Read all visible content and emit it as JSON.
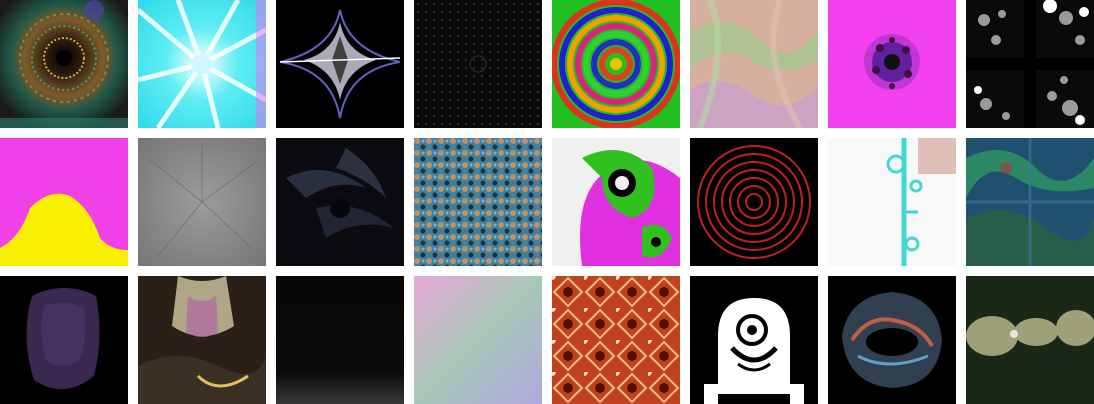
{
  "gallery": {
    "rows": 3,
    "columns": 8,
    "tiles": [
      {
        "name": "dark-mandala-pattern",
        "dominant_colors": [
          "#1a1a1a",
          "#c08030",
          "#30a080"
        ]
      },
      {
        "name": "cyan-starburst-pattern",
        "dominant_colors": [
          "#40e8f0",
          "#ffffff",
          "#f070f0"
        ]
      },
      {
        "name": "white-cross-star-on-black",
        "dominant_colors": [
          "#000000",
          "#d8d8f0",
          "#6060c0"
        ]
      },
      {
        "name": "dark-dotted-texture",
        "dominant_colors": [
          "#0c0c0c",
          "#2a2a2a"
        ]
      },
      {
        "name": "rainbow-concentric-rings",
        "dominant_colors": [
          "#20c020",
          "#e03020",
          "#2020d0",
          "#f0a000"
        ]
      },
      {
        "name": "pastel-marbled-texture",
        "dominant_colors": [
          "#d8b0a0",
          "#a0c890",
          "#c8a0d0"
        ]
      },
      {
        "name": "magenta-with-dark-flower",
        "dominant_colors": [
          "#f040f0",
          "#301030",
          "#6020a0"
        ]
      },
      {
        "name": "grey-bubbles-cross",
        "dominant_colors": [
          "#101010",
          "#c0c0c0",
          "#ffffff"
        ]
      },
      {
        "name": "magenta-yellow-mound",
        "dominant_colors": [
          "#f040e8",
          "#f8f000"
        ]
      },
      {
        "name": "grey-faint-star",
        "dominant_colors": [
          "#7a7a7a",
          "#9a9a9a"
        ]
      },
      {
        "name": "dark-feather-swirl",
        "dominant_colors": [
          "#0c0c10",
          "#30384a"
        ]
      },
      {
        "name": "blue-orange-mosaic",
        "dominant_colors": [
          "#4080a0",
          "#c09060",
          "#203040"
        ]
      },
      {
        "name": "green-magenta-eye-swirl",
        "dominant_colors": [
          "#30c020",
          "#f0f0f0",
          "#e030e0",
          "#000000"
        ]
      },
      {
        "name": "red-spiral-on-black",
        "dominant_colors": [
          "#000000",
          "#c02020"
        ]
      },
      {
        "name": "white-with-cyan-vine",
        "dominant_colors": [
          "#f8f8f8",
          "#40d8d0",
          "#d0a8a0"
        ]
      },
      {
        "name": "teal-blue-green-texture",
        "dominant_colors": [
          "#205070",
          "#30a060",
          "#a04040"
        ]
      },
      {
        "name": "purple-blob-on-black",
        "dominant_colors": [
          "#000000",
          "#3a2850"
        ]
      },
      {
        "name": "sepia-glass-sculpture",
        "dominant_colors": [
          "#2a2018",
          "#d0c8a0",
          "#b070a0"
        ]
      },
      {
        "name": "near-black-gradient",
        "dominant_colors": [
          "#080808",
          "#303030"
        ]
      },
      {
        "name": "pastel-gradient-square",
        "dominant_colors": [
          "#e8a8d8",
          "#90c8a0",
          "#b0a8e0"
        ]
      },
      {
        "name": "red-lace-pattern",
        "dominant_colors": [
          "#c04020",
          "#f0c080",
          "#501008"
        ]
      },
      {
        "name": "white-eye-creature-on-black",
        "dominant_colors": [
          "#000000",
          "#ffffff"
        ]
      },
      {
        "name": "iridescent-dark-shape",
        "dominant_colors": [
          "#000000",
          "#304050",
          "#c06040"
        ]
      },
      {
        "name": "dark-green-with-tan-blobs",
        "dominant_colors": [
          "#1a2818",
          "#a0a078"
        ]
      }
    ]
  }
}
